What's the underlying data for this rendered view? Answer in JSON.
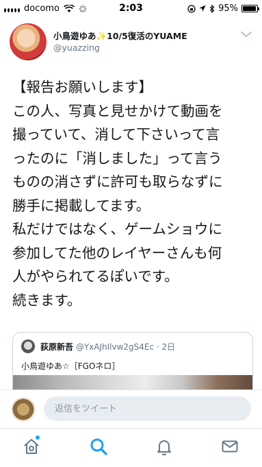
{
  "status_bar": {
    "carrier": "docomo",
    "time": "2:03",
    "battery_percent": "95%",
    "battery_level": 0.95
  },
  "tweet": {
    "display_name": "小鳥遊ゆあ✨10/5復活のYUAME",
    "handle": "@yuazzing",
    "lines": [
      "【報告お願いします】",
      "この人、写真と見せかけて動画を",
      "撮っていて、消して下さいって言",
      "ったのに「消しました」って言う",
      "ものの消さずに許可も取らなずに",
      "勝手に掲載してます。",
      "私だけではなく、ゲームショウに",
      "参加してた他のレイヤーさんも何",
      "人がやられてるぽいです。",
      "続きます。"
    ]
  },
  "quoted_tweet": {
    "display_name": "荻原新吾",
    "handle_time": "@YxAJhIlvw2gS4Ec · 2日",
    "text": "小鳥遊ゆあ☆［FGOネロ］"
  },
  "reply": {
    "placeholder": "返信をツイート"
  },
  "tabs": [
    {
      "name": "home-tab",
      "icon": "home-icon",
      "active": false,
      "has_dot": true
    },
    {
      "name": "search-tab",
      "icon": "search-icon",
      "active": true,
      "has_dot": false
    },
    {
      "name": "notifications-tab",
      "icon": "bell-icon",
      "active": false,
      "has_dot": false
    },
    {
      "name": "messages-tab",
      "icon": "mail-icon",
      "active": false,
      "has_dot": false
    }
  ],
  "colors": {
    "accent": "#1da1f2",
    "text": "#14171a",
    "secondary_text": "#657786",
    "border": "#e1e8ed"
  }
}
